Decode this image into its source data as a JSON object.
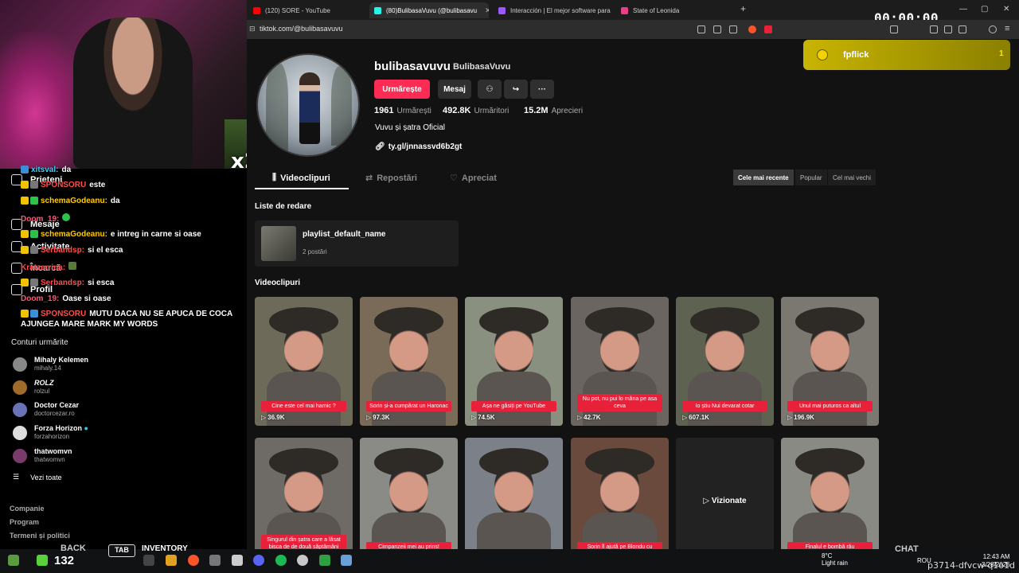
{
  "browser": {
    "tabs": [
      {
        "label": "(120) SORE - YouTube",
        "color": "#ff0000"
      },
      {
        "label": "(80)BulibasaVuvu (@bulibasavu",
        "color": "#25f4ee"
      },
      {
        "label": "Interacción | El mejor software para",
        "color": "#9b59ff"
      },
      {
        "label": "State of Leonida",
        "color": "#e83e8c"
      }
    ],
    "new_tab": "+",
    "url": "tiktok.com/@bulibasavuvu",
    "timer": "00:00:00"
  },
  "fp_banner": {
    "name": "fpflick",
    "count": "1"
  },
  "stream": {
    "multiplier": "x2"
  },
  "left_nav": [
    {
      "label": "Prieteni",
      "icon": "friends-icon"
    },
    {
      "label": "Mesaje",
      "icon": "message-icon"
    },
    {
      "label": "Activitate",
      "icon": "activity-icon"
    },
    {
      "label": "Încarcă",
      "icon": "upload-icon"
    },
    {
      "label": "Profil",
      "icon": "profile-icon"
    }
  ],
  "chat": [
    {
      "user": "xitsval:",
      "text": "da",
      "color": "#3ad1ff"
    },
    {
      "user": "SPONSORU",
      "text": "este",
      "color": "#ff4d4d"
    },
    {
      "user": "schemaGodeanu:",
      "text": "da",
      "color": "#ffcc00"
    },
    {
      "user": "Doom_19:",
      "text": "",
      "color": "#ff5577"
    },
    {
      "user": "schemaGodeanu:",
      "text": "e intreg in carne si oase",
      "color": "#ffcc00"
    },
    {
      "user": "Serbandsp:",
      "text": "si el esca",
      "color": "#ff4d4d"
    },
    {
      "user": "Kratzerrina:",
      "text": "",
      "color": "#ff4d4d"
    },
    {
      "user": "Serbandsp:",
      "text": "si esca",
      "color": "#ff4d4d"
    },
    {
      "user": "Doom_19:",
      "text": "Oase si oase",
      "color": "#ff5577"
    },
    {
      "user": "SPONSORU",
      "text": "MUTU DACA NU SE APUCA DE COCA AJUNGEA MARE MARK MY WORDS",
      "color": "#ff4d4d"
    }
  ],
  "following": {
    "title": "Conturi urmărite",
    "accounts": [
      {
        "name": "Mihaly Kelemen",
        "handle": "mihaly.14"
      },
      {
        "name": "ROLZ",
        "handle": "rolzul"
      },
      {
        "name": "Doctor Cezar",
        "handle": "doctorcezar.ro"
      },
      {
        "name": "Forza Horizon",
        "handle": "forzahorizon"
      },
      {
        "name": "thatwomvn",
        "handle": "thatwomvn"
      }
    ],
    "see_all": "Vezi toate"
  },
  "footer_links": [
    "Companie",
    "Program",
    "Termeni și politici"
  ],
  "profile": {
    "username": "bulibasavuvu",
    "nickname": "BulibasaVuvu",
    "follow_label": "Urmărește",
    "message_label": "Mesaj",
    "more_label": "···",
    "stats": [
      {
        "value": "1961",
        "label": "Urmărești"
      },
      {
        "value": "492.8K",
        "label": "Urmăritori"
      },
      {
        "value": "15.2M",
        "label": "Aprecieri"
      }
    ],
    "bio": "Vuvu și șatra Oficial",
    "link": "ty.gl/jnnassvd6b2gt"
  },
  "content_tabs": [
    {
      "label": "Videoclipuri",
      "icon": "grid-icon"
    },
    {
      "label": "Repostări",
      "icon": "repost-icon"
    },
    {
      "label": "Apreciat",
      "icon": "heart-icon"
    }
  ],
  "sort": [
    "Cele mai recente",
    "Popular",
    "Cel mai vechi"
  ],
  "playlists": {
    "heading": "Liste de redare",
    "name": "playlist_default_name",
    "count": "2 postări"
  },
  "videos": {
    "heading": "Videoclipuri",
    "items": [
      {
        "caption": "Cine este cel mai harnic ?",
        "views": "36.9K",
        "bg": "#6d6a5a"
      },
      {
        "caption": "Sorin și-a cumpărat un Haronac",
        "views": "97.3K",
        "bg": "#7a6a58"
      },
      {
        "caption": "Așa ne găsiți pe YouTube",
        "views": "74.5K",
        "bg": "#8a9080"
      },
      {
        "caption": "Nu pot, nu pui lo mâna pe asa ceva",
        "views": "42.7K",
        "bg": "#6a6560"
      },
      {
        "caption": "Io știu Nui devarat cotar",
        "views": "607.1K",
        "bg": "#5e6250"
      },
      {
        "caption": "Unul mai puturos ca altul",
        "views": "196.9K",
        "bg": "#7a7870"
      },
      {
        "caption": "Singurul din șatra care a lăsat bisca de de două săptămâni",
        "views": "",
        "bg": "#6e6a66"
      },
      {
        "caption": "Cimpanzeii mei au prins!",
        "views": "",
        "bg": "#8a8a86"
      },
      {
        "caption": "",
        "views": "",
        "bg": "#7c8088"
      },
      {
        "caption": "Sorin îl ajută pe Blondu cu",
        "views": "",
        "bg": "#6a4a3c"
      },
      {
        "caption": "",
        "views": "",
        "bg": "#222222",
        "overlay": "Vizionate"
      },
      {
        "caption": "Finalul e bombă rău",
        "views": "",
        "bg": "#8a8a84"
      }
    ]
  },
  "taskbar": {
    "count": "132",
    "back": "BACK",
    "tab": "TAB",
    "inventory": "INVENTORY",
    "chat": "CHAT",
    "weather_temp": "8°C",
    "weather_desc": "Light rain",
    "lang": "ROU",
    "time": "12:43 AM",
    "date": "3/28/2026",
    "overlay_id": "p3714-dfvcw-q1o1d"
  }
}
